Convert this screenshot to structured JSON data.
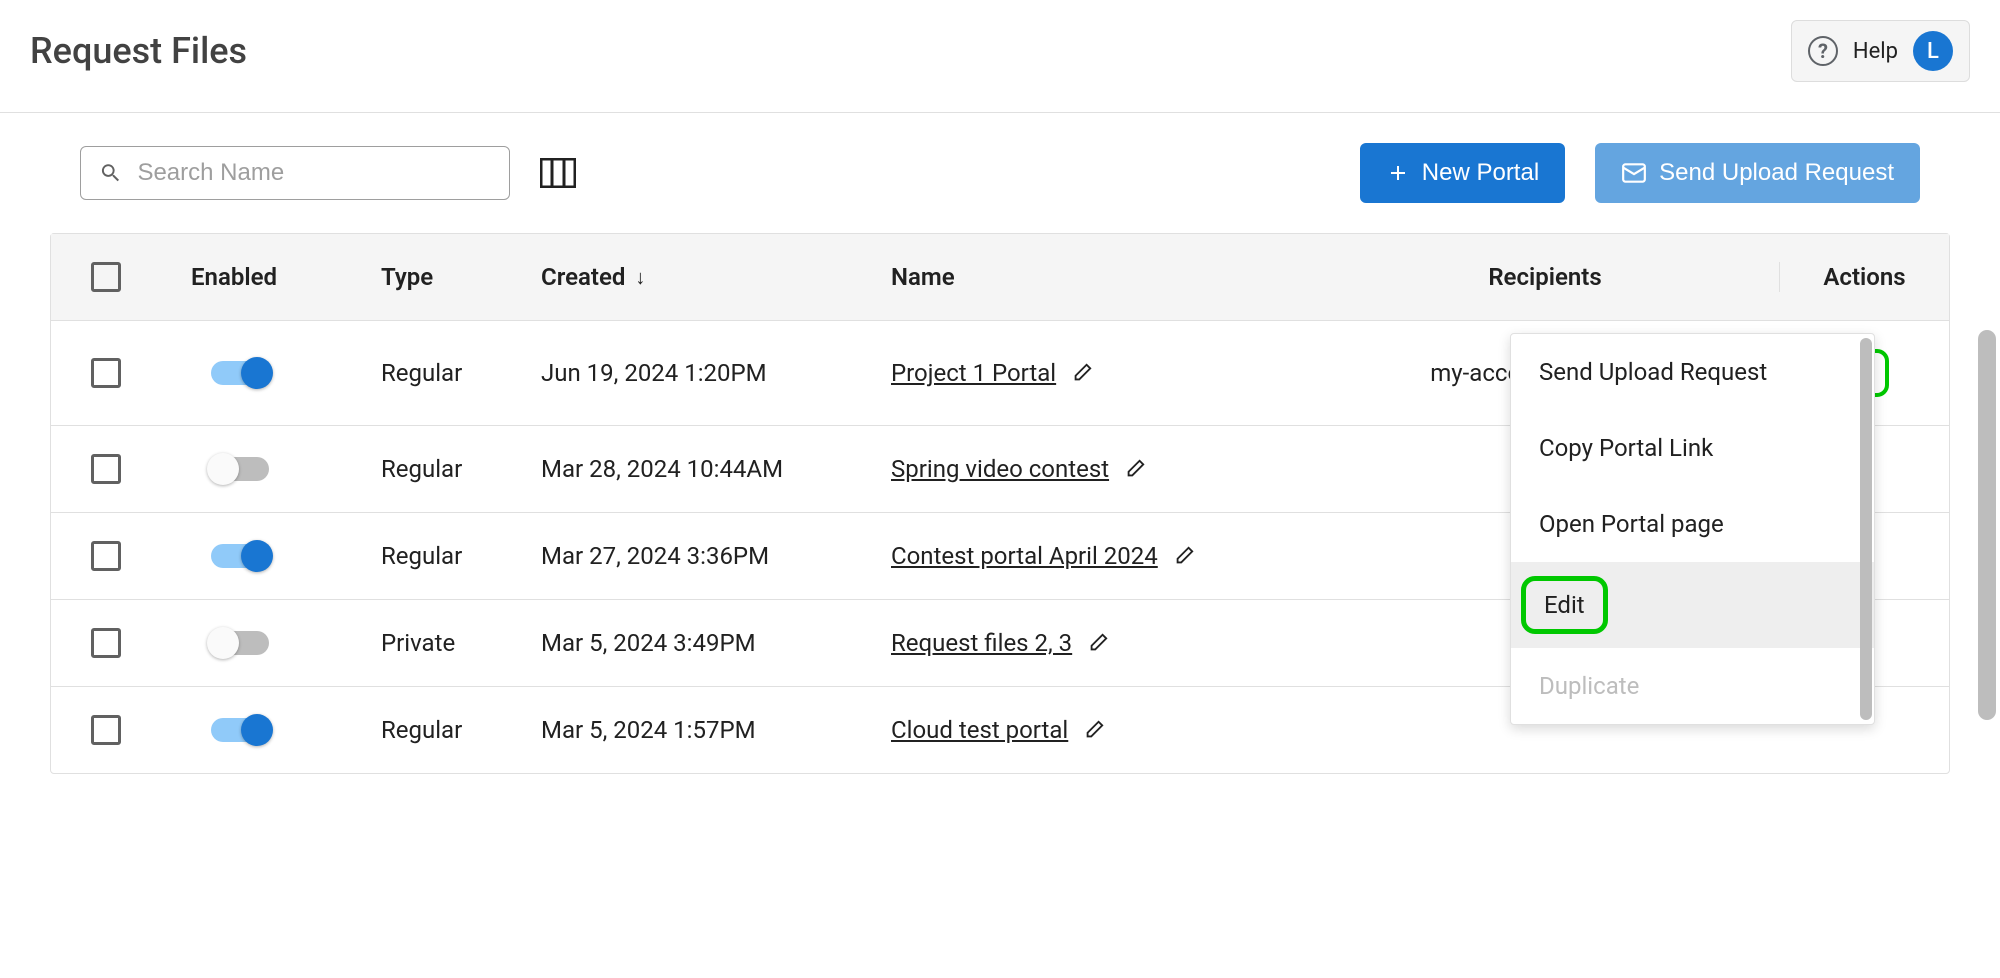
{
  "header": {
    "title": "Request Files",
    "help": "Help",
    "avatar_initial": "L"
  },
  "toolbar": {
    "search_placeholder": "Search Name",
    "new_portal": "New Portal",
    "send_upload": "Send Upload Request"
  },
  "columns": {
    "enabled": "Enabled",
    "type": "Type",
    "created": "Created",
    "name": "Name",
    "recipients": "Recipients",
    "actions": "Actions"
  },
  "rows": [
    {
      "enabled": true,
      "type": "Regular",
      "created": "Jun 19, 2024 1:20PM",
      "name": "Project 1 Portal",
      "recipients": "my-account@masv.io"
    },
    {
      "enabled": false,
      "type": "Regular",
      "created": "Mar 28, 2024 10:44AM",
      "name": "Spring video contest",
      "recipients": ""
    },
    {
      "enabled": true,
      "type": "Regular",
      "created": "Mar 27, 2024 3:36PM",
      "name": "Contest portal April 2024",
      "recipients": ""
    },
    {
      "enabled": false,
      "type": "Private",
      "created": "Mar 5, 2024 3:49PM",
      "name": "Request files 2, 3",
      "recipients": ""
    },
    {
      "enabled": true,
      "type": "Regular",
      "created": "Mar 5, 2024 1:57PM",
      "name": "Cloud test portal",
      "recipients": ""
    }
  ],
  "dropdown": {
    "send_upload": "Send Upload Request",
    "copy_link": "Copy Portal Link",
    "open_page": "Open Portal page",
    "edit": "Edit",
    "duplicate": "Duplicate"
  }
}
